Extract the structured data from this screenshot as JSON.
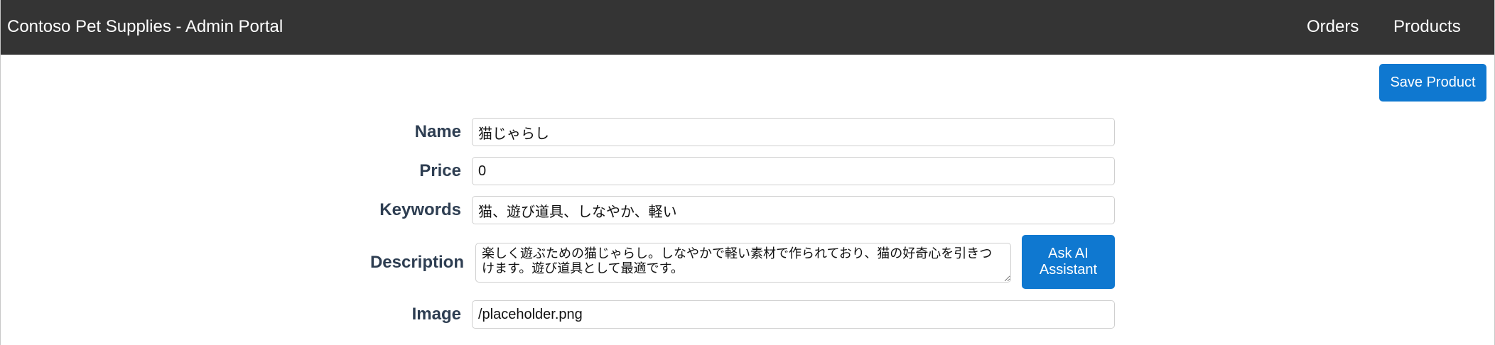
{
  "header": {
    "brand": "Contoso Pet Supplies - Admin Portal",
    "nav": {
      "orders": "Orders",
      "products": "Products"
    }
  },
  "toolbar": {
    "save_label": "Save Product"
  },
  "form": {
    "name": {
      "label": "Name",
      "value": "猫じゃらし"
    },
    "price": {
      "label": "Price",
      "value": "0"
    },
    "keywords": {
      "label": "Keywords",
      "value": "猫、遊び道具、しなやか、軽い"
    },
    "description": {
      "label": "Description",
      "value": "楽しく遊ぶための猫じゃらし。しなやかで軽い素材で作られており、猫の好奇心を引きつけます。遊び道具として最適です。"
    },
    "ask_ai_label": "Ask AI Assistant",
    "image": {
      "label": "Image",
      "value": "/placeholder.png"
    }
  },
  "colors": {
    "navbar_bg": "#343434",
    "accent_button": "#0f78d0",
    "label_text": "#2e3e52"
  }
}
